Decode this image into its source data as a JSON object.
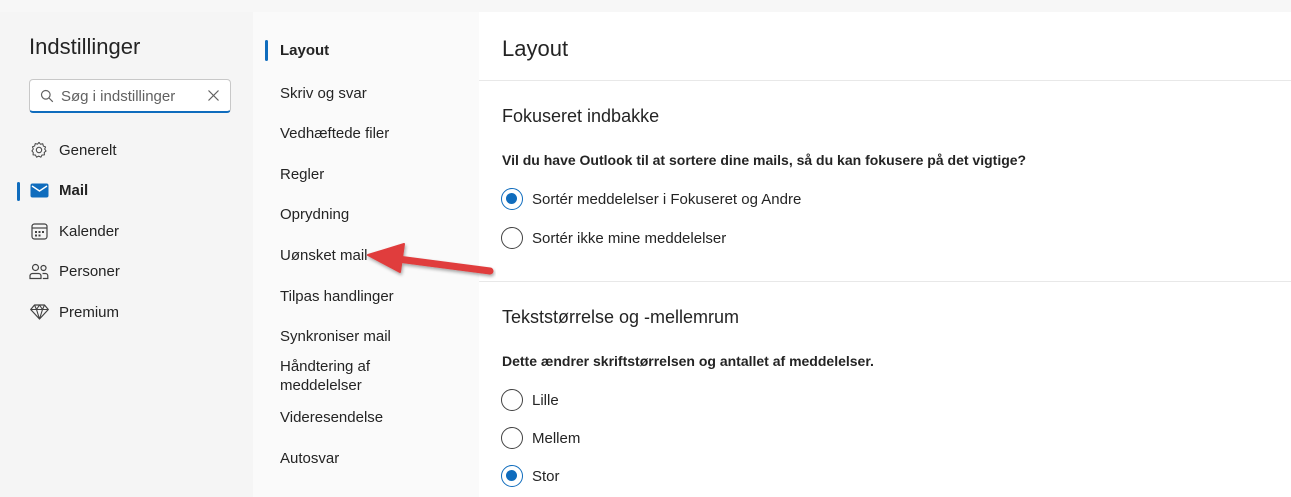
{
  "settings_panel": {
    "title": "Indstillinger",
    "search": {
      "placeholder": "Søg i indstillinger"
    },
    "categories": [
      {
        "label": "Generelt",
        "icon": "gear-icon"
      },
      {
        "label": "Mail",
        "icon": "mail-icon",
        "active": true
      },
      {
        "label": "Kalender",
        "icon": "calendar-icon"
      },
      {
        "label": "Personer",
        "icon": "people-icon"
      },
      {
        "label": "Premium",
        "icon": "diamond-icon"
      }
    ]
  },
  "mail_subnav": {
    "items": [
      {
        "label": "Layout",
        "active": true
      },
      {
        "label": "Skriv og svar"
      },
      {
        "label": "Vedhæftede filer"
      },
      {
        "label": "Regler"
      },
      {
        "label": "Oprydning"
      },
      {
        "label": "Uønsket mail"
      },
      {
        "label": "Tilpas handlinger"
      },
      {
        "label": "Synkroniser mail"
      },
      {
        "label": "Håndtering af meddelelser"
      },
      {
        "label": "Videresendelse"
      },
      {
        "label": "Autosvar"
      }
    ]
  },
  "content": {
    "page_title": "Layout",
    "focused_inbox": {
      "heading": "Fokuseret indbakke",
      "question": "Vil du have Outlook til at sortere dine mails, så du kan fokusere på det vigtige?",
      "options": [
        {
          "label": "Sortér meddelelser i Fokuseret og Andre",
          "selected": true
        },
        {
          "label": "Sortér ikke mine meddelelser",
          "selected": false
        }
      ]
    },
    "text_size": {
      "heading": "Tekststørrelse og -mellemrum",
      "description": "Dette ændrer skriftstørrelsen og antallet af meddelelser.",
      "options": [
        {
          "label": "Lille",
          "selected": false
        },
        {
          "label": "Mellem",
          "selected": false
        },
        {
          "label": "Stor",
          "selected": true
        }
      ]
    }
  },
  "annotation": {
    "arrow_color": "#e03c3c",
    "points_to": "Uønsket mail"
  },
  "colors": {
    "accent": "#0f6cbd"
  }
}
